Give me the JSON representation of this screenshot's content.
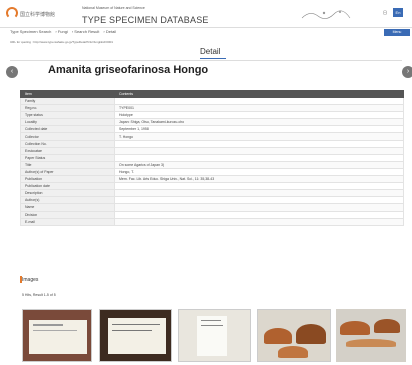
{
  "header": {
    "logo_jp": "国立科学博物館",
    "logo_en_small": "National Museum of Nature and Science",
    "logo_en": "TYPE SPECIMEN DATABASE",
    "lang_jp": "日",
    "lang_en": "En"
  },
  "nav": {
    "crumbs": [
      "Type Specimen Search",
      "Fungi",
      "Search Result",
      "Detail"
    ],
    "menu": "Menu"
  },
  "permalink": "URL for quoting : http://www.type.kahaku.go.jp/TypeDetail?cls=fungi&id=0001",
  "page_title": "Detail",
  "specimen_name": "Amanita griseofarinosa Hongo",
  "table": {
    "headers": [
      "Item",
      "Contents"
    ],
    "rows": [
      {
        "k": "Family",
        "v": ""
      },
      {
        "k": "Reg.no.",
        "v": "TYPE001"
      },
      {
        "k": "Type status",
        "v": "Holotype"
      },
      {
        "k": "Locality",
        "v": "Japan: Shiga, Otsu, Tanakami-kurozu-cho"
      },
      {
        "k": "Collected date",
        "v": "September 1, 1958"
      },
      {
        "k": "Collector",
        "v": "T. Hongo"
      },
      {
        "k": "Collection No.",
        "v": ""
      },
      {
        "k": "Exsiccatae",
        "v": ""
      },
      {
        "k": "Paper Status",
        "v": ""
      },
      {
        "k": "Title",
        "v": "On some Agarics of Japan 3)"
      },
      {
        "k": "Author(s) of Paper",
        "v": "Hongo, T."
      },
      {
        "k": "Publication",
        "v": "Mem. Fac. Lib. Arts Educ. Shiga Univ., Nat. Sci., 11: 35,38-43"
      },
      {
        "k": "Publication date",
        "v": ""
      },
      {
        "k": "Description",
        "v": ""
      },
      {
        "k": "Author(s)",
        "v": ""
      },
      {
        "k": "Name",
        "v": ""
      },
      {
        "k": "Division",
        "v": ""
      },
      {
        "k": "E-mail",
        "v": ""
      }
    ]
  },
  "images": {
    "heading": "Images",
    "hits": "5 Hits, Result 1-5 of 5"
  },
  "colors": {
    "accent": "#e47a2c",
    "brand_blue": "#3a6bb5",
    "table_header": "#555555"
  }
}
